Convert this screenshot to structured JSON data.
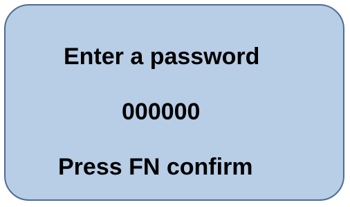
{
  "display": {
    "prompt": "Enter a password",
    "password_value": "000000",
    "hint": "Press FN confirm",
    "colors": {
      "screen_background": "#b8cde6",
      "screen_border": "#4e6d8e",
      "text": "#000000"
    }
  }
}
